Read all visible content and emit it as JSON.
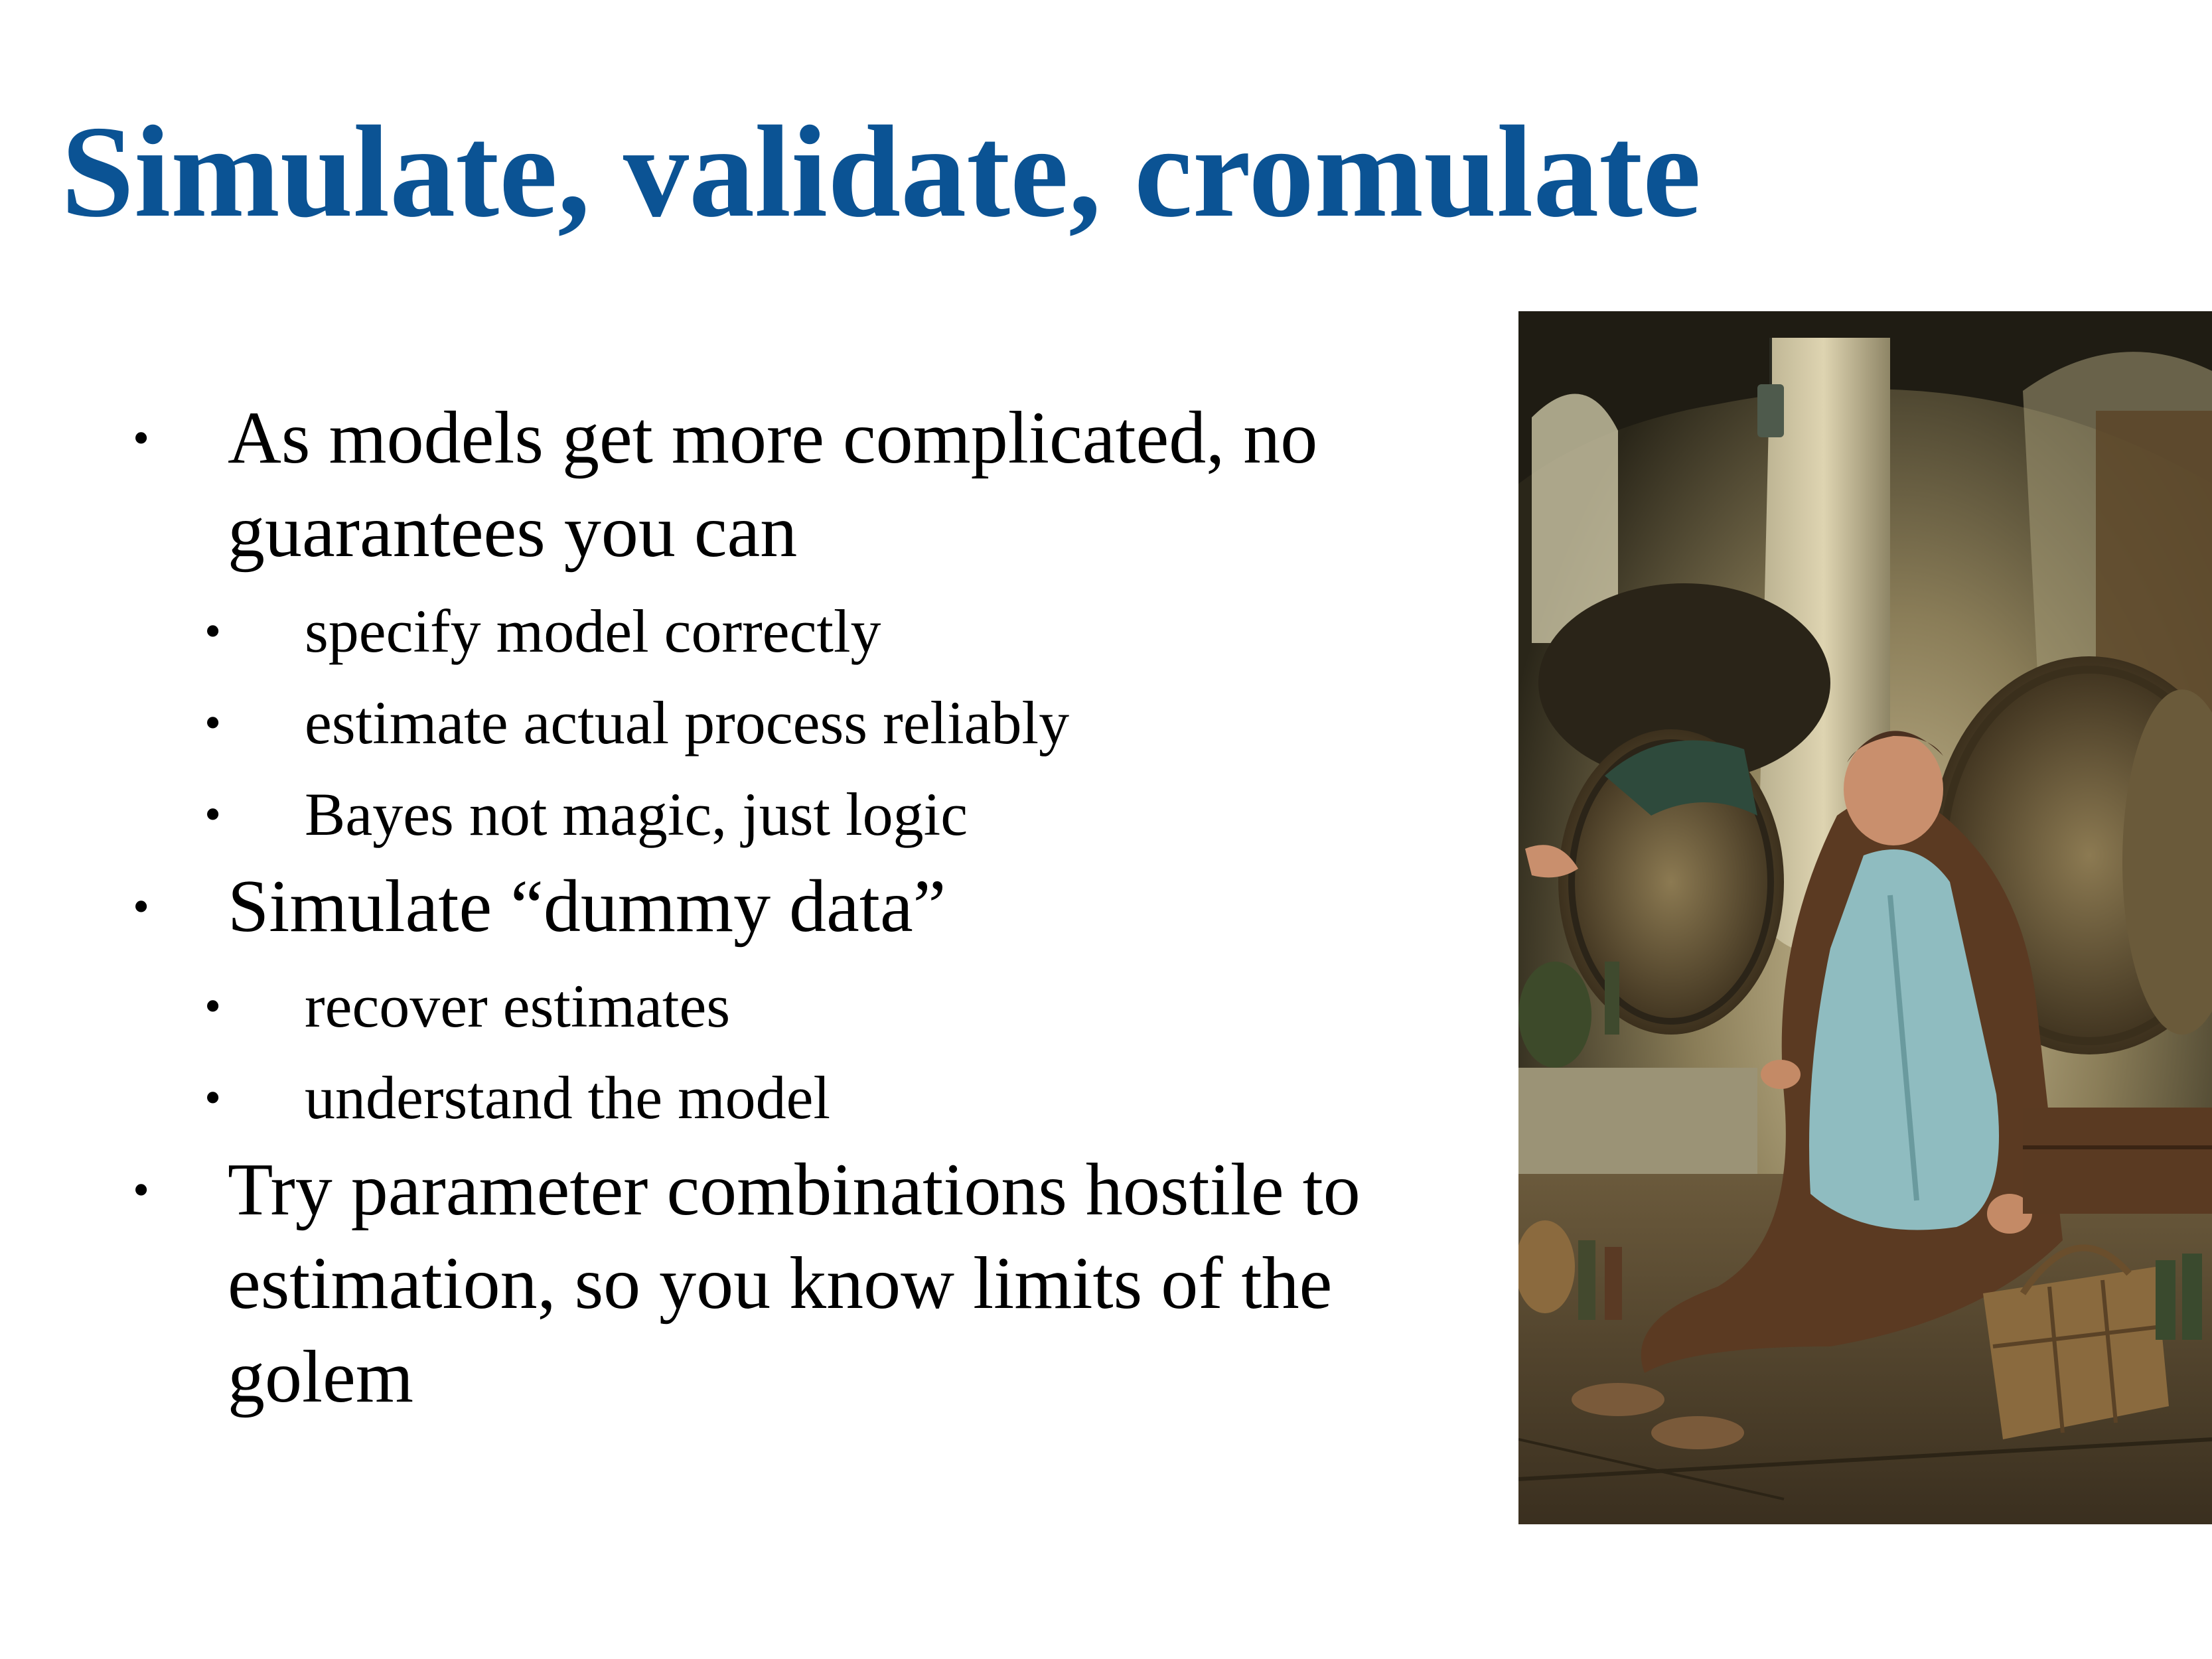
{
  "slide": {
    "title": "Simulate, validate, cromulate",
    "bullets": [
      {
        "text": "As models get more complicated, no guarantees you can",
        "sub": [
          "specify model correctly",
          "estimate actual process reliably",
          "Bayes not magic, just logic"
        ]
      },
      {
        "text": "Simulate “dummy data”",
        "sub": [
          "recover estimates",
          "understand the model"
        ]
      },
      {
        "text": "Try parameter combinations hostile to estimation, so you know limits of the golem",
        "sub": []
      }
    ],
    "bullet_glyph": "•",
    "image": {
      "alt": "",
      "icon": "painting-sleeping-monk-with-barrels"
    }
  },
  "colors": {
    "title": "#0b5394",
    "text": "#000000",
    "background": "#ffffff"
  }
}
